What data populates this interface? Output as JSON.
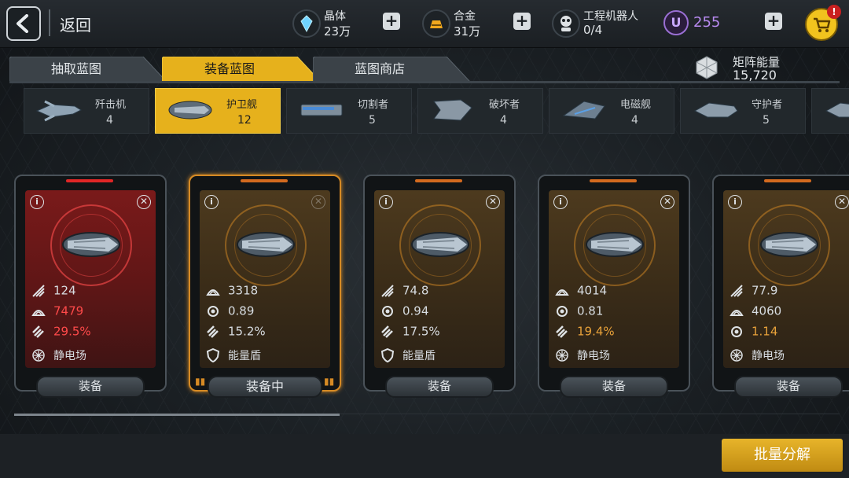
{
  "header": {
    "back_label": "返回",
    "resources": [
      {
        "name": "晶体",
        "value": "23万",
        "icon": "crystal-icon"
      },
      {
        "name": "合金",
        "value": "31万",
        "icon": "alloy-icon"
      },
      {
        "name": "工程机器人",
        "value": "0/4",
        "icon": "robot-icon"
      }
    ],
    "premium": {
      "symbol": "U",
      "value": "255"
    },
    "cart_badge": "!"
  },
  "tabs": [
    {
      "label": "抽取蓝图",
      "active": false
    },
    {
      "label": "装备蓝图",
      "active": true
    },
    {
      "label": "蓝图商店",
      "active": false
    }
  ],
  "matrix_energy": {
    "label": "矩阵能量",
    "value": "15,720"
  },
  "ship_classes": [
    {
      "name": "歼击机",
      "count": "4",
      "active": false
    },
    {
      "name": "护卫舰",
      "count": "12",
      "active": true
    },
    {
      "name": "切割者",
      "count": "5",
      "active": false
    },
    {
      "name": "破坏者",
      "count": "4",
      "active": false
    },
    {
      "name": "电磁舰",
      "count": "4",
      "active": false
    },
    {
      "name": "守护者",
      "count": "5",
      "active": false
    }
  ],
  "cards": [
    {
      "style": "red",
      "stats": [
        {
          "icon": "attack-icon",
          "value": "124",
          "tone": "normal"
        },
        {
          "icon": "armor-icon",
          "value": "7479",
          "tone": "warn"
        },
        {
          "icon": "missile-icon",
          "value": "29.5%",
          "tone": "warn"
        },
        {
          "icon": "static-field-icon",
          "value": "静电场",
          "tone": "normal"
        }
      ],
      "button": "装备",
      "equipped": false
    },
    {
      "style": "gold",
      "stats": [
        {
          "icon": "armor-icon",
          "value": "3318",
          "tone": "normal"
        },
        {
          "icon": "gear-icon",
          "value": "0.89",
          "tone": "normal"
        },
        {
          "icon": "missile-icon",
          "value": "15.2%",
          "tone": "normal"
        },
        {
          "icon": "shield-icon",
          "value": "能量盾",
          "tone": "normal"
        }
      ],
      "button": "装备中",
      "equipped": true
    },
    {
      "style": "gold",
      "stats": [
        {
          "icon": "attack-icon",
          "value": "74.8",
          "tone": "normal"
        },
        {
          "icon": "gear-icon",
          "value": "0.94",
          "tone": "normal"
        },
        {
          "icon": "missile-icon",
          "value": "17.5%",
          "tone": "normal"
        },
        {
          "icon": "shield-icon",
          "value": "能量盾",
          "tone": "normal"
        }
      ],
      "button": "装备",
      "equipped": false
    },
    {
      "style": "gold",
      "stats": [
        {
          "icon": "armor-icon",
          "value": "4014",
          "tone": "normal"
        },
        {
          "icon": "gear-icon",
          "value": "0.81",
          "tone": "normal"
        },
        {
          "icon": "missile-icon",
          "value": "19.4%",
          "tone": "gold"
        },
        {
          "icon": "static-field-icon",
          "value": "静电场",
          "tone": "normal"
        }
      ],
      "button": "装备",
      "equipped": false
    },
    {
      "style": "gold",
      "stats": [
        {
          "icon": "attack-icon",
          "value": "77.9",
          "tone": "normal"
        },
        {
          "icon": "armor-icon",
          "value": "4060",
          "tone": "normal"
        },
        {
          "icon": "gear-icon",
          "value": "1.14",
          "tone": "gold"
        },
        {
          "icon": "static-field-icon",
          "value": "静电场",
          "tone": "normal"
        }
      ],
      "button": "装备",
      "equipped": false
    }
  ],
  "batch_button": "批量分解",
  "colors": {
    "accent": "#e6b11c",
    "warn": "#ff4a4a",
    "gold_value": "#e8a23a",
    "premium": "#b88af0"
  }
}
